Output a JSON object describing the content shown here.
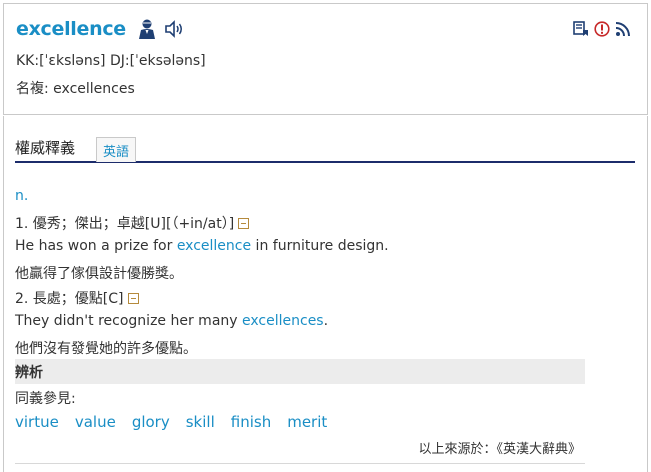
{
  "header": {
    "headword": "excellence",
    "phonetic": "KK:[ˈɛksləns] DJ:[ˈeksələns]",
    "plural": "名複: excellences",
    "icons": [
      "person-speaker-icon",
      "sound-icon",
      "wordbook-icon",
      "report-icon",
      "rss-icon"
    ]
  },
  "section": {
    "title": "權威釋義",
    "tab_label": "英語"
  },
  "entries": {
    "pos": "n.",
    "sense1_def": "1. 優秀；傑出；卓越[U][（+in/at）]",
    "example1_pre": "He has won a prize for ",
    "example1_hl": "excellence",
    "example1_post": " in furniture design.",
    "example1_zh": "他贏得了傢俱設計優勝獎。",
    "sense2_def": "2. 長處；優點[C]",
    "example2_pre": "They didn't recognize her many ",
    "example2_hl": "excellences",
    "example2_post": ".",
    "example2_zh": "他們沒有發覺她的許多優點。"
  },
  "analysis": {
    "title": "辨析",
    "synonym_label": "同義參見:",
    "synonyms": [
      "virtue",
      "value",
      "glory",
      "skill",
      "finish",
      "merit"
    ],
    "source": "以上來源於：《英漢大辭典》"
  },
  "colors": {
    "accent": "#1a8ec5",
    "rule": "#1c2c6b",
    "analysis_bg": "#ececec"
  }
}
